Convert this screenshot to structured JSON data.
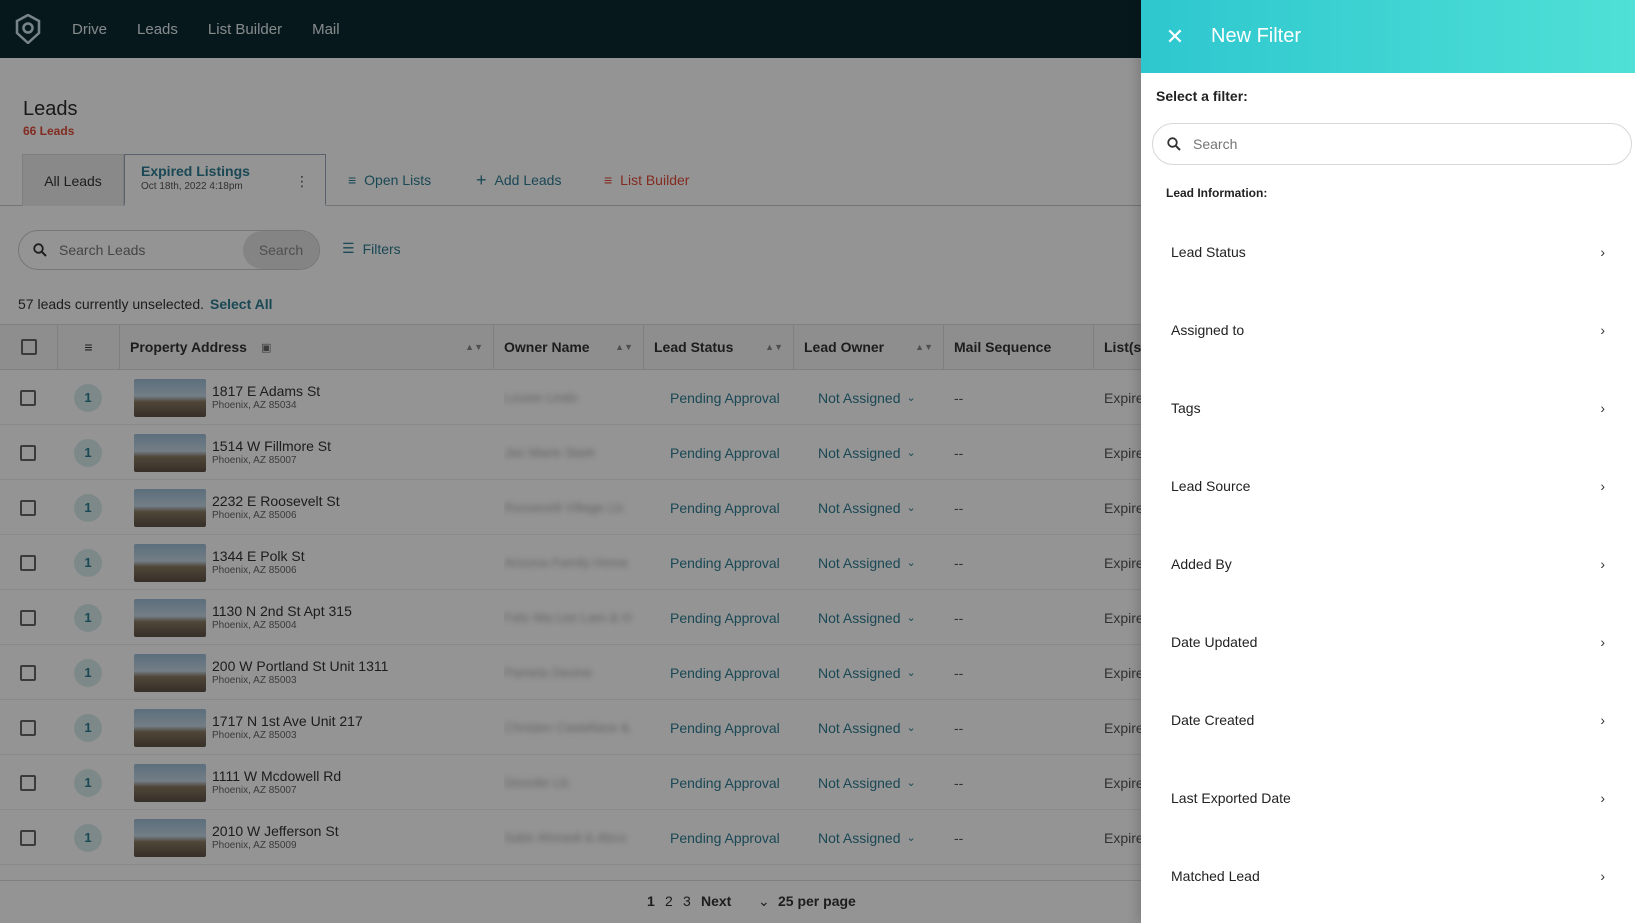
{
  "nav": {
    "items": [
      "Drive",
      "Leads",
      "List Builder",
      "Mail"
    ]
  },
  "page": {
    "title": "Leads",
    "count_label": "66 Leads"
  },
  "tabs": {
    "all": "All Leads",
    "expired": {
      "title": "Expired Listings",
      "date": "Oct 18th, 2022 4:18pm"
    },
    "open_lists": "Open Lists",
    "add_leads": "Add Leads",
    "list_builder": "List Builder"
  },
  "search": {
    "placeholder": "Search Leads",
    "button": "Search",
    "filters": "Filters"
  },
  "selection": {
    "text": "57 leads currently unselected.",
    "select_all": "Select All"
  },
  "table": {
    "columns": [
      "Property Address",
      "Owner Name",
      "Lead Status",
      "Lead Owner",
      "Mail Sequence",
      "List(s"
    ],
    "rows": [
      {
        "badge": "1",
        "street": "1817 E Adams St",
        "city": "Phoenix, AZ 85034",
        "owner": "Louise Lindo",
        "status": "Pending Approval",
        "lead_owner": "Not Assigned",
        "mail": "--",
        "list": "Expire"
      },
      {
        "badge": "1",
        "street": "1514 W Fillmore St",
        "city": "Phoenix, AZ 85007",
        "owner": "Jan Marie Stark",
        "status": "Pending Approval",
        "lead_owner": "Not Assigned",
        "mail": "--",
        "list": "Expire"
      },
      {
        "badge": "1",
        "street": "2232 E Roosevelt St",
        "city": "Phoenix, AZ 85006",
        "owner": "Roosevelt Village Llc",
        "status": "Pending Approval",
        "lead_owner": "Not Assigned",
        "mail": "--",
        "list": "Expire"
      },
      {
        "badge": "1",
        "street": "1344 E Polk St",
        "city": "Phoenix, AZ 85006",
        "owner": "Arizona Family Home",
        "status": "Pending Approval",
        "lead_owner": "Not Assigned",
        "mail": "--",
        "list": "Expire"
      },
      {
        "badge": "1",
        "street": "1130 N 2nd St Apt 315",
        "city": "Phoenix, AZ 85004",
        "owner": "Felo Wa Lee Lam & H",
        "status": "Pending Approval",
        "lead_owner": "Not Assigned",
        "mail": "--",
        "list": "Expire"
      },
      {
        "badge": "1",
        "street": "200 W Portland St Unit 1311",
        "city": "Phoenix, AZ 85003",
        "owner": "Pamela Devine",
        "status": "Pending Approval",
        "lead_owner": "Not Assigned",
        "mail": "--",
        "list": "Expire"
      },
      {
        "badge": "1",
        "street": "1717 N 1st Ave Unit 217",
        "city": "Phoenix, AZ 85003",
        "owner": "Christen Castellane &",
        "status": "Pending Approval",
        "lead_owner": "Not Assigned",
        "mail": "--",
        "list": "Expire"
      },
      {
        "badge": "1",
        "street": "1111 W Mcdowell Rd",
        "city": "Phoenix, AZ 85007",
        "owner": "Deordie Llc",
        "status": "Pending Approval",
        "lead_owner": "Not Assigned",
        "mail": "--",
        "list": "Expire"
      },
      {
        "badge": "1",
        "street": "2010 W Jefferson St",
        "city": "Phoenix, AZ 85009",
        "owner": "Sabir Ahmedi & Abco",
        "status": "Pending Approval",
        "lead_owner": "Not Assigned",
        "mail": "--",
        "list": "Expire"
      }
    ]
  },
  "pager": {
    "pages": [
      "1",
      "2",
      "3"
    ],
    "next": "Next",
    "per_page": "25 per page"
  },
  "panel": {
    "title": "New Filter",
    "select_label": "Select a filter:",
    "search_placeholder": "Search",
    "section": "Lead Information:",
    "items": [
      "Lead Status",
      "Assigned to",
      "Tags",
      "Lead Source",
      "Added By",
      "Date Updated",
      "Date Created",
      "Last Exported Date",
      "Matched Lead"
    ]
  },
  "colors": {
    "nav_bg": "#0d2a33",
    "accent": "#2d7d93",
    "alert": "#e04d3a",
    "panel_header": "#2ec7cf"
  }
}
